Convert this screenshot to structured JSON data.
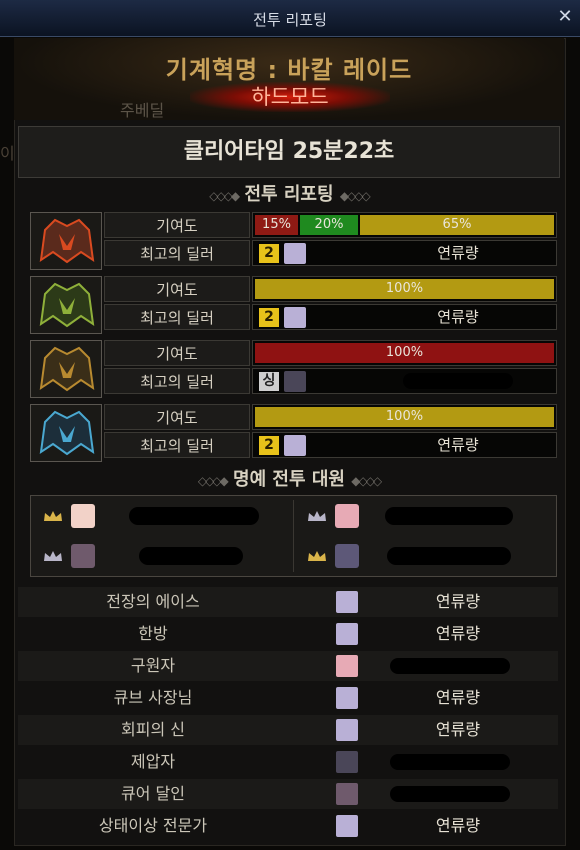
{
  "window": {
    "title": "전투 리포팅",
    "close_label": "✕"
  },
  "header": {
    "raid_name": "기계혁명 : 바칼 레이드",
    "mode": "하드모드",
    "faded_text": "주베딜",
    "faded_text2": "이"
  },
  "clear_time": "클리어타임  25분22초",
  "sections": {
    "battle_report": "전투 리포팅",
    "honor": "명예 전투 대원"
  },
  "bosses": [
    {
      "contribution_label": "기여도",
      "best_dealer_label": "최고의 딜러",
      "bars": [
        {
          "text": "15%",
          "value": 15,
          "color": "#8f1a14"
        },
        {
          "text": "20%",
          "value": 20,
          "color": "#1f8a1f"
        },
        {
          "text": "65%",
          "value": 65,
          "color": "#b39a12"
        }
      ],
      "rank": "2",
      "dealer": "연류량",
      "icon": "fire-dragon-head-icon",
      "rank_color": "gold"
    },
    {
      "contribution_label": "기여도",
      "best_dealer_label": "최고의 딜러",
      "bars": [
        {
          "text": "100%",
          "value": 100,
          "color": "#b39a12"
        }
      ],
      "rank": "2",
      "dealer": "연류량",
      "icon": "green-dragon-head-icon",
      "rank_color": "gold"
    },
    {
      "contribution_label": "기여도",
      "best_dealer_label": "최고의 딜러",
      "bars": [
        {
          "text": "100%",
          "value": 100,
          "color": "#8f1212"
        }
      ],
      "rank": "싱",
      "dealer": "",
      "icon": "gold-dragon-head-icon",
      "rank_color": "gray"
    },
    {
      "contribution_label": "기여도",
      "best_dealer_label": "최고의 딜러",
      "bars": [
        {
          "text": "100%",
          "value": 100,
          "color": "#b39a12"
        }
      ],
      "rank": "2",
      "dealer": "연류량",
      "icon": "ice-dragon-head-icon",
      "rank_color": "gold"
    }
  ],
  "awards": [
    {
      "title": "전장의 에이스",
      "player": "연류량"
    },
    {
      "title": "한방",
      "player": "연류량"
    },
    {
      "title": "구원자",
      "player": ""
    },
    {
      "title": "큐브 사장님",
      "player": "연류량"
    },
    {
      "title": "회피의 신",
      "player": "연류량"
    },
    {
      "title": "제압자",
      "player": ""
    },
    {
      "title": "큐어 달인",
      "player": ""
    },
    {
      "title": "상태이상 전문가",
      "player": "연류량"
    }
  ],
  "colors": {
    "accent_gold": "#c9a25a",
    "mode_red": "#d21d0a",
    "rank_gold": "#e8c21a"
  }
}
